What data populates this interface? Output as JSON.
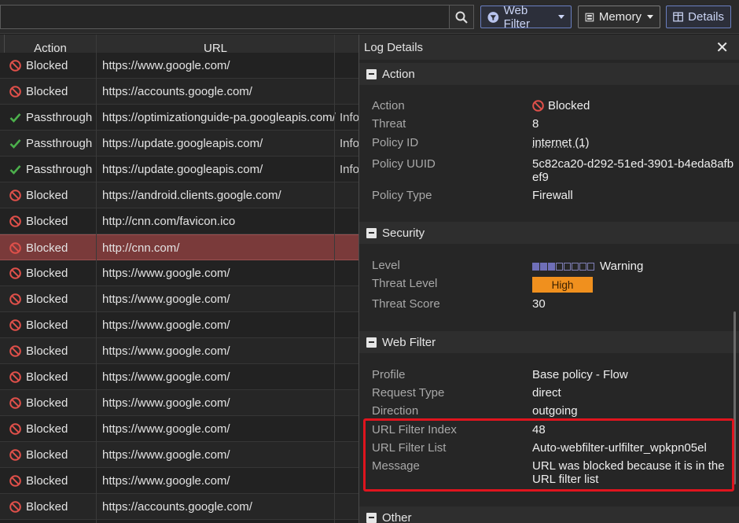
{
  "toolbar": {
    "search_placeholder": "",
    "webfilter_label": "Web Filter",
    "memory_label": "Memory",
    "details_label": "Details"
  },
  "table": {
    "headers": {
      "action": "Action",
      "url": "URL"
    },
    "rows": [
      {
        "action": "Blocked",
        "status": "blocked",
        "url": "https://www.google.com/",
        "extra": ""
      },
      {
        "action": "Blocked",
        "status": "blocked",
        "url": "https://accounts.google.com/",
        "extra": ""
      },
      {
        "action": "Passthrough",
        "status": "pass",
        "url": "https://optimizationguide-pa.googleapis.com/",
        "extra": "Info"
      },
      {
        "action": "Passthrough",
        "status": "pass",
        "url": "https://update.googleapis.com/",
        "extra": "Info"
      },
      {
        "action": "Passthrough",
        "status": "pass",
        "url": "https://update.googleapis.com/",
        "extra": "Info"
      },
      {
        "action": "Blocked",
        "status": "blocked",
        "url": "https://android.clients.google.com/",
        "extra": ""
      },
      {
        "action": "Blocked",
        "status": "blocked",
        "url": "http://cnn.com/favicon.ico",
        "extra": ""
      },
      {
        "action": "Blocked",
        "status": "blocked",
        "url": "http://cnn.com/",
        "extra": "",
        "selected": true
      },
      {
        "action": "Blocked",
        "status": "blocked",
        "url": "https://www.google.com/",
        "extra": ""
      },
      {
        "action": "Blocked",
        "status": "blocked",
        "url": "https://www.google.com/",
        "extra": ""
      },
      {
        "action": "Blocked",
        "status": "blocked",
        "url": "https://www.google.com/",
        "extra": ""
      },
      {
        "action": "Blocked",
        "status": "blocked",
        "url": "https://www.google.com/",
        "extra": ""
      },
      {
        "action": "Blocked",
        "status": "blocked",
        "url": "https://www.google.com/",
        "extra": ""
      },
      {
        "action": "Blocked",
        "status": "blocked",
        "url": "https://www.google.com/",
        "extra": ""
      },
      {
        "action": "Blocked",
        "status": "blocked",
        "url": "https://www.google.com/",
        "extra": ""
      },
      {
        "action": "Blocked",
        "status": "blocked",
        "url": "https://www.google.com/",
        "extra": ""
      },
      {
        "action": "Blocked",
        "status": "blocked",
        "url": "https://www.google.com/",
        "extra": ""
      },
      {
        "action": "Blocked",
        "status": "blocked",
        "url": "https://accounts.google.com/",
        "extra": ""
      }
    ]
  },
  "details": {
    "title": "Log Details",
    "close": "✕",
    "action_section": {
      "title": "Action",
      "action_label": "Action",
      "action_value": "Blocked",
      "threat_label": "Threat",
      "threat_value": "8",
      "policy_id_label": "Policy ID",
      "policy_id_value": "internet (1)",
      "policy_uuid_label": "Policy UUID",
      "policy_uuid_value": "5c82ca20-d292-51ed-3901-b4eda8afbef9",
      "policy_type_label": "Policy Type",
      "policy_type_value": "Firewall"
    },
    "security_section": {
      "title": "Security",
      "level_label": "Level",
      "level_value": "Warning",
      "level_filled": 3,
      "level_total": 8,
      "threat_level_label": "Threat Level",
      "threat_level_value": "High",
      "threat_score_label": "Threat Score",
      "threat_score_value": "30"
    },
    "webfilter_section": {
      "title": "Web Filter",
      "profile_label": "Profile",
      "profile_value": "Base policy - Flow",
      "request_type_label": "Request Type",
      "request_type_value": "direct",
      "direction_label": "Direction",
      "direction_value": "outgoing",
      "url_filter_index_label": "URL Filter Index",
      "url_filter_index_value": "48",
      "url_filter_list_label": "URL Filter List",
      "url_filter_list_value": "Auto-webfilter-urlfilter_wpkpn05el",
      "message_label": "Message",
      "message_value": "URL was blocked because it is in the URL filter list"
    },
    "other_section": {
      "title": "Other"
    }
  },
  "colors": {
    "blocked": "#e0504a",
    "pass": "#4cb04c",
    "selected_row": "#7a3a3a",
    "high_badge": "#f0901e",
    "highlight_box": "#e0141e"
  }
}
